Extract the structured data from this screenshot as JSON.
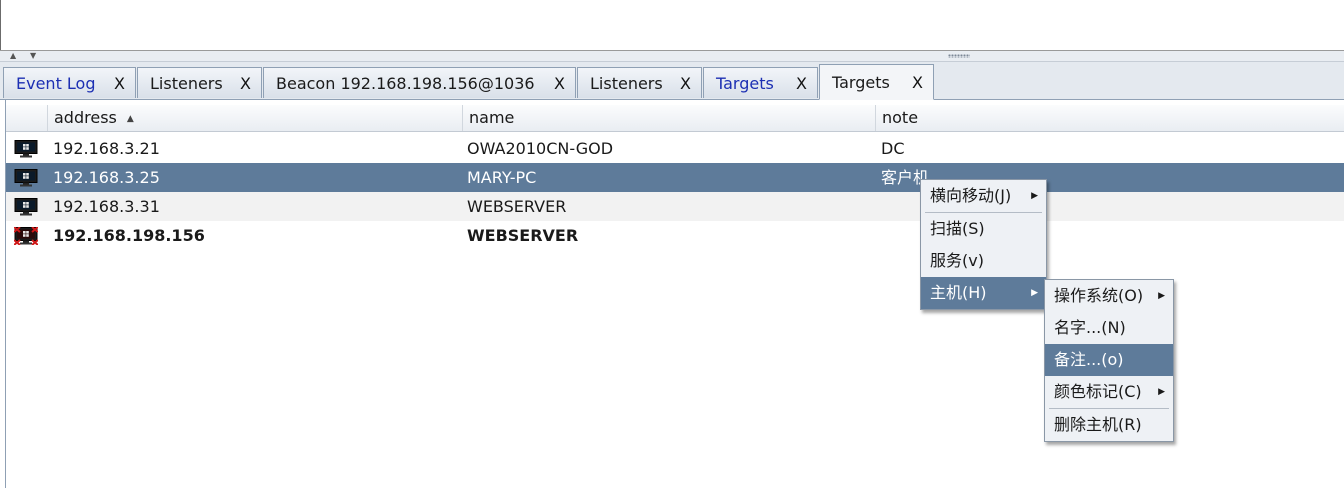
{
  "tabs": [
    {
      "label": "Event Log",
      "close": "X",
      "blue": true
    },
    {
      "label": "Listeners",
      "close": "X",
      "blue": false
    },
    {
      "label": "Beacon 192.168.198.156@1036",
      "close": "X",
      "blue": false
    },
    {
      "label": "Listeners",
      "close": "X",
      "blue": false
    },
    {
      "label": "Targets",
      "close": "X",
      "blue": true
    },
    {
      "label": "Targets",
      "close": "X",
      "blue": false,
      "active": true
    }
  ],
  "table": {
    "columns": [
      "address",
      "name",
      "note"
    ],
    "sort_indicator": "▲",
    "rows": [
      {
        "address": "192.168.3.21",
        "name": "OWA2010CN-GOD",
        "note": "DC",
        "icon": "windows-host-icon"
      },
      {
        "address": "192.168.3.25",
        "name": "MARY-PC",
        "note": "客户机",
        "icon": "windows-host-icon",
        "selected": true
      },
      {
        "address": "192.168.3.31",
        "name": "WEBSERVER",
        "note": "",
        "icon": "windows-host-icon"
      },
      {
        "address": "192.168.198.156",
        "name": "WEBSERVER",
        "note": "",
        "icon": "compromised-host-icon",
        "bold": true
      }
    ]
  },
  "context_menu": {
    "items": [
      "横向移动(J)",
      "扫描(S)",
      "服务(v)",
      "主机(H)"
    ]
  },
  "host_submenu": {
    "items": [
      "操作系统(O)",
      "名字...(N)",
      "备注...(o)",
      "颜色标记(C)",
      "删除主机(R)"
    ]
  },
  "colors": {
    "selection": "#5e7b9a",
    "tab_blue_text": "#1c2fb3",
    "menu_bg": "#eef1f5"
  }
}
